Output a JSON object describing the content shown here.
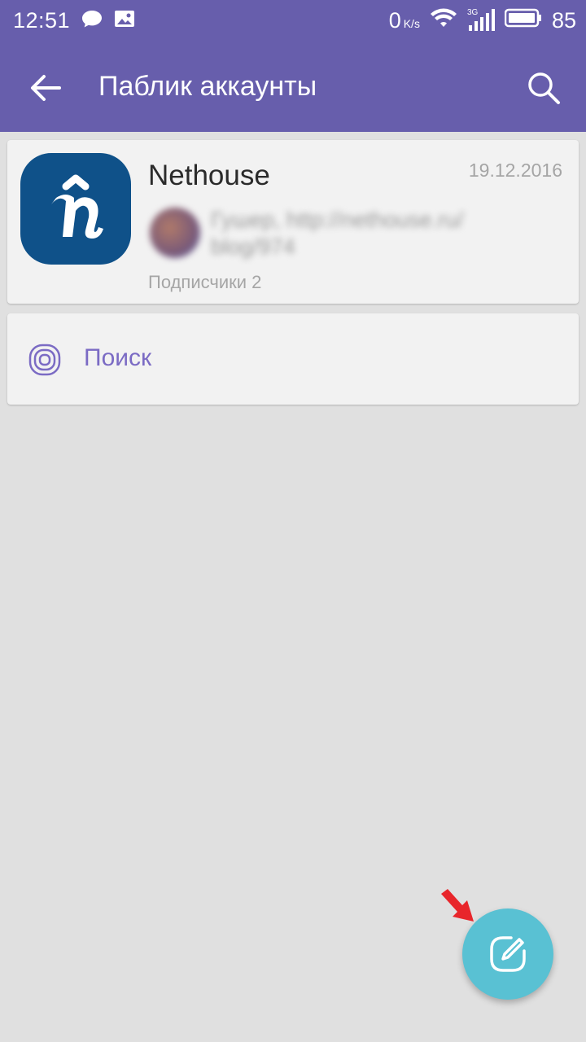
{
  "status_bar": {
    "time": "12:51",
    "net_speed": "0",
    "net_unit": "K/s",
    "network_type": "3G",
    "battery": "85",
    "icons": [
      "chat-bubble-icon",
      "image-icon",
      "wifi-icon",
      "signal-icon",
      "battery-icon"
    ]
  },
  "toolbar": {
    "title": "Паблик аккаунты",
    "back_icon": "arrow-back-icon",
    "search_icon": "search-icon"
  },
  "account": {
    "name": "Nethouse",
    "date": "19.12.2016",
    "preview_text": "Гушер, http://nethouse.ru/ blog/974",
    "subscribers": "Подписчики 2"
  },
  "search_item": {
    "label": "Поиск",
    "icon": "public-accounts-icon"
  },
  "fab": {
    "icon": "compose-icon"
  },
  "colors": {
    "primary": "#675eac",
    "accent": "#7b6bc4",
    "fab": "#59c1d3",
    "background": "#e0e0e0",
    "annotation_arrow": "#e8262b"
  }
}
